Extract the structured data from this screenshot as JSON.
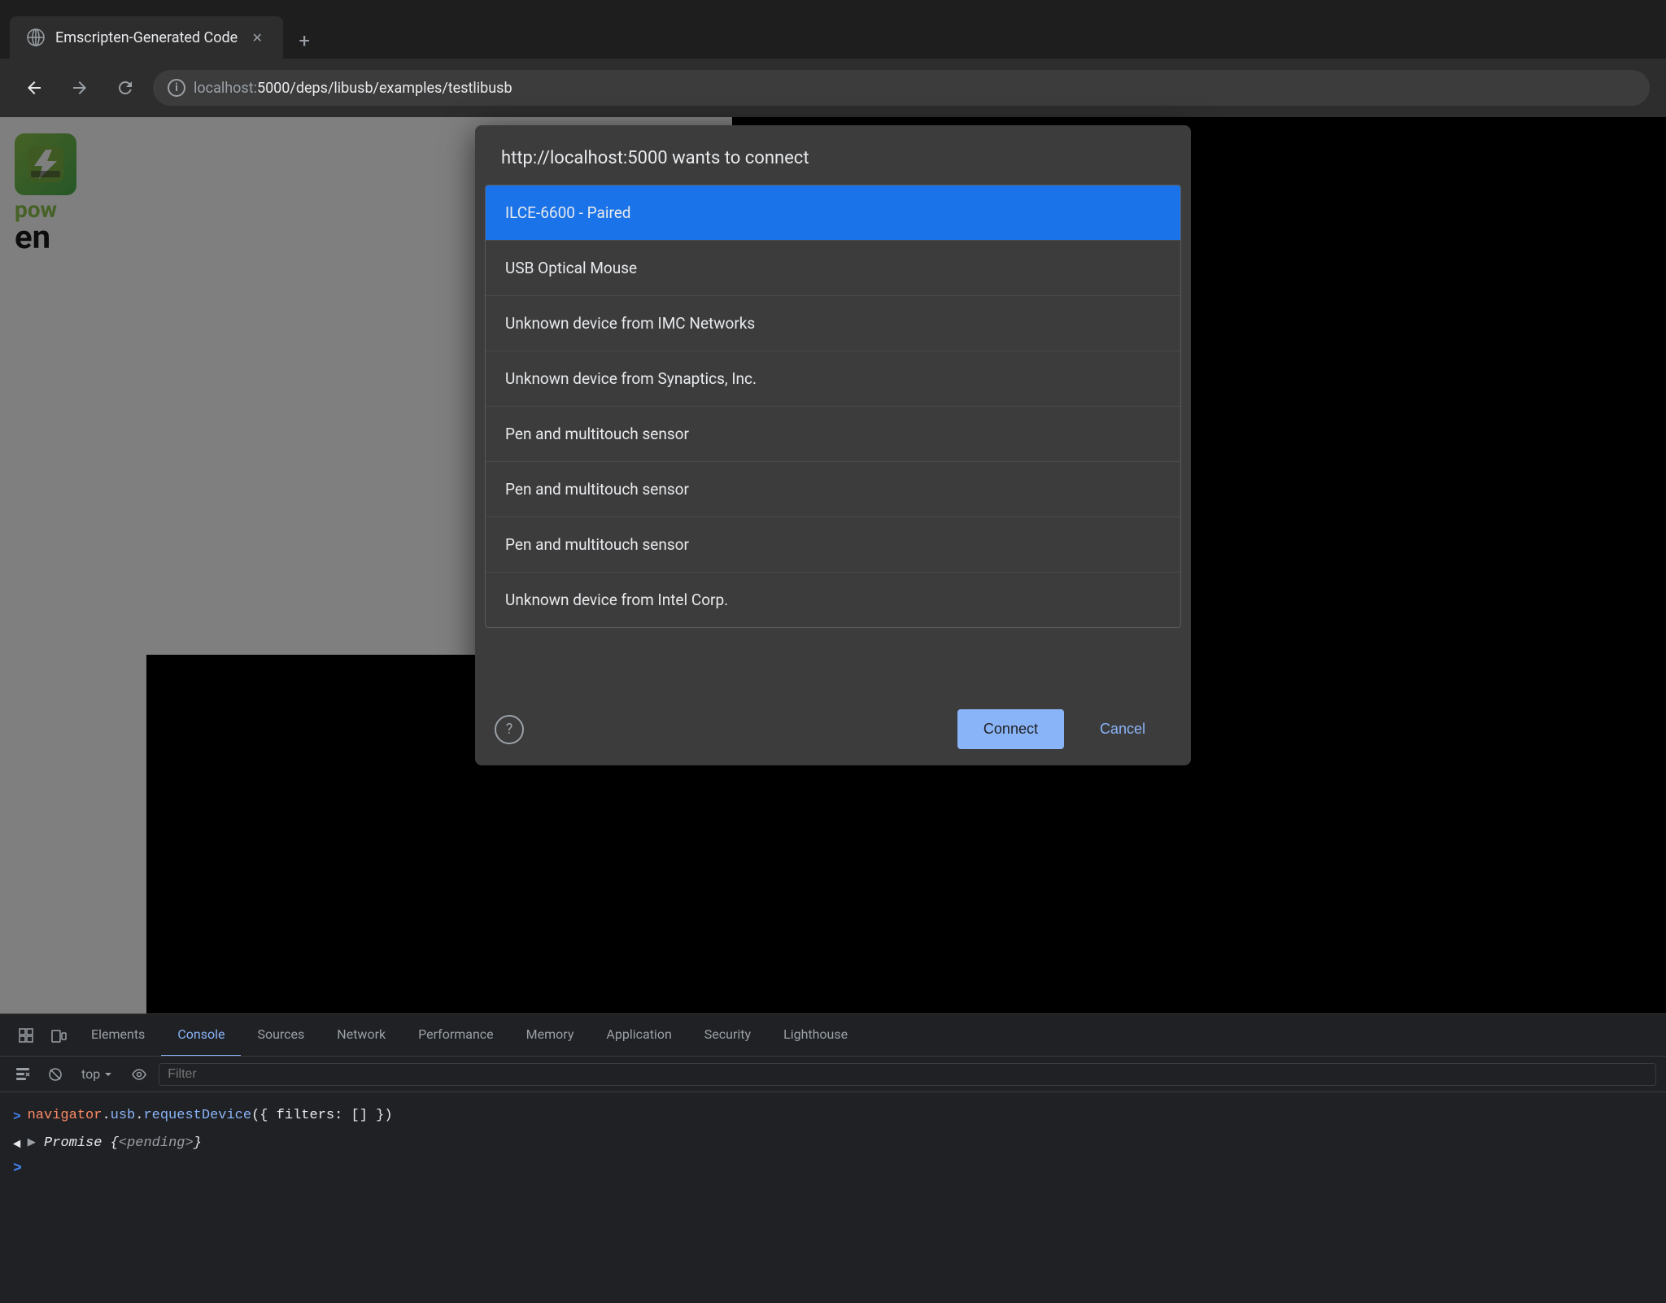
{
  "browser": {
    "tab": {
      "title": "Emscripten-Generated Code",
      "favicon_label": "globe-icon"
    },
    "new_tab_label": "+",
    "nav": {
      "back_label": "←",
      "forward_label": "→",
      "refresh_label": "↻",
      "url": "localhost:5000/deps/libusb/examples/testlibusb",
      "protocol": "localhost:",
      "path": "5000/deps/libusb/examples/testlibusb"
    }
  },
  "dialog": {
    "title": "http://localhost:5000 wants to connect",
    "devices": [
      {
        "id": "device-0",
        "name": "ILCE-6600 - Paired",
        "selected": true
      },
      {
        "id": "device-1",
        "name": "USB Optical Mouse",
        "selected": false
      },
      {
        "id": "device-2",
        "name": "Unknown device from IMC Networks",
        "selected": false
      },
      {
        "id": "device-3",
        "name": "Unknown device from Synaptics, Inc.",
        "selected": false
      },
      {
        "id": "device-4",
        "name": "Pen and multitouch sensor",
        "selected": false
      },
      {
        "id": "device-5",
        "name": "Pen and multitouch sensor",
        "selected": false
      },
      {
        "id": "device-6",
        "name": "Pen and multitouch sensor",
        "selected": false
      },
      {
        "id": "device-7",
        "name": "Unknown device from Intel Corp.",
        "selected": false
      }
    ],
    "connect_label": "Connect",
    "cancel_label": "Cancel",
    "help_label": "?"
  },
  "devtools": {
    "tabs": [
      {
        "id": "elements",
        "label": "Elements"
      },
      {
        "id": "console",
        "label": "Console",
        "active": true
      },
      {
        "id": "sources",
        "label": "Sources"
      },
      {
        "id": "network",
        "label": "Network"
      },
      {
        "id": "performance",
        "label": "Performance"
      },
      {
        "id": "memory",
        "label": "Memory"
      },
      {
        "id": "application",
        "label": "Application"
      },
      {
        "id": "security",
        "label": "Security"
      },
      {
        "id": "lighthouse",
        "label": "Lighthouse"
      }
    ],
    "toolbar": {
      "context": "top",
      "filter_placeholder": "Filter"
    },
    "console": {
      "lines": [
        {
          "type": "input",
          "prefix": ">",
          "text": "navigator.usb.requestDevice({ filters: [] })"
        },
        {
          "type": "output",
          "prefix": "◄",
          "italic": true,
          "text": "Promise {<pending>}"
        }
      ],
      "prompt_prefix": ">"
    }
  }
}
